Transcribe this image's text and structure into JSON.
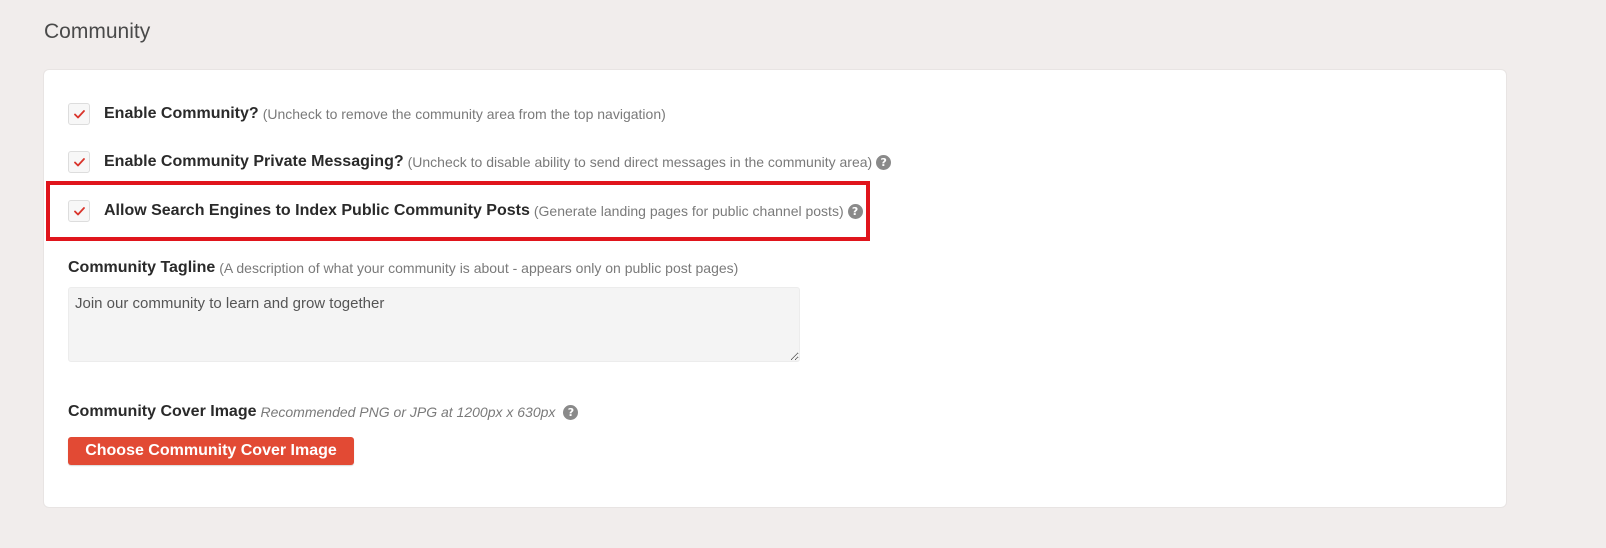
{
  "section": {
    "title": "Community"
  },
  "options": [
    {
      "label": "Enable Community?",
      "hint": "(Uncheck to remove the community area from the top navigation)",
      "checked": true,
      "help": false
    },
    {
      "label": "Enable Community Private Messaging?",
      "hint": "(Uncheck to disable ability to send direct messages in the community area)",
      "checked": true,
      "help": true
    },
    {
      "label": "Allow Search Engines to Index Public Community Posts",
      "hint": "(Generate landing pages for public channel posts)",
      "checked": true,
      "help": true
    }
  ],
  "help_glyph": "?",
  "tagline": {
    "label": "Community Tagline",
    "hint": "(A description of what your community is about - appears only on public post pages)",
    "value": "Join our community to learn and grow together"
  },
  "cover_image": {
    "label": "Community Cover Image",
    "hint": "Recommended PNG or JPG at 1200px x 630px",
    "button_label": "Choose Community Cover Image"
  },
  "colors": {
    "accent": "#e24a34",
    "highlight": "#e0151c",
    "check": "#d9342b"
  },
  "icons": {
    "check": "check-icon",
    "help": "help-icon"
  }
}
